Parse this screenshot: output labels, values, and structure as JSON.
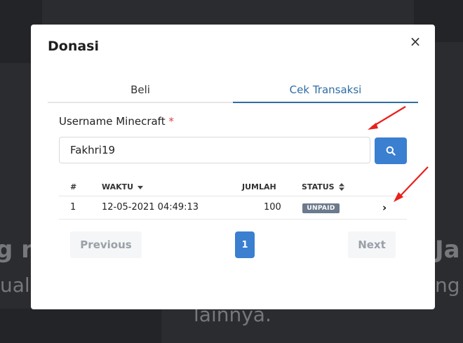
{
  "modal": {
    "title": "Donasi",
    "close_label": "×"
  },
  "tabs": [
    {
      "label": "Beli"
    },
    {
      "label": "Cek Transaksi"
    }
  ],
  "form": {
    "label": "Username Minecraft",
    "required_mark": "*",
    "username_value": "Fakhri19"
  },
  "table": {
    "headers": {
      "no": "#",
      "waktu": "WAKTU",
      "jumlah": "JUMLAH",
      "status": "STATUS"
    },
    "rows": [
      {
        "no": "1",
        "waktu": "12-05-2021 04:49:13",
        "jumlah": "100",
        "status": "UNPAID"
      }
    ]
  },
  "pagination": {
    "previous": "Previous",
    "current_page": "1",
    "next": "Next"
  },
  "background": {
    "left_fragment_1": "g n",
    "left_fragment_2": "ual",
    "right_fragment_1": "Ja",
    "right_fragment_2": "ng",
    "bottom_fragment": "lainnya."
  },
  "colors": {
    "accent": "#3b7fd0",
    "annotation_arrow": "#e8211d",
    "badge_unpaid": "#6b7a8c"
  }
}
